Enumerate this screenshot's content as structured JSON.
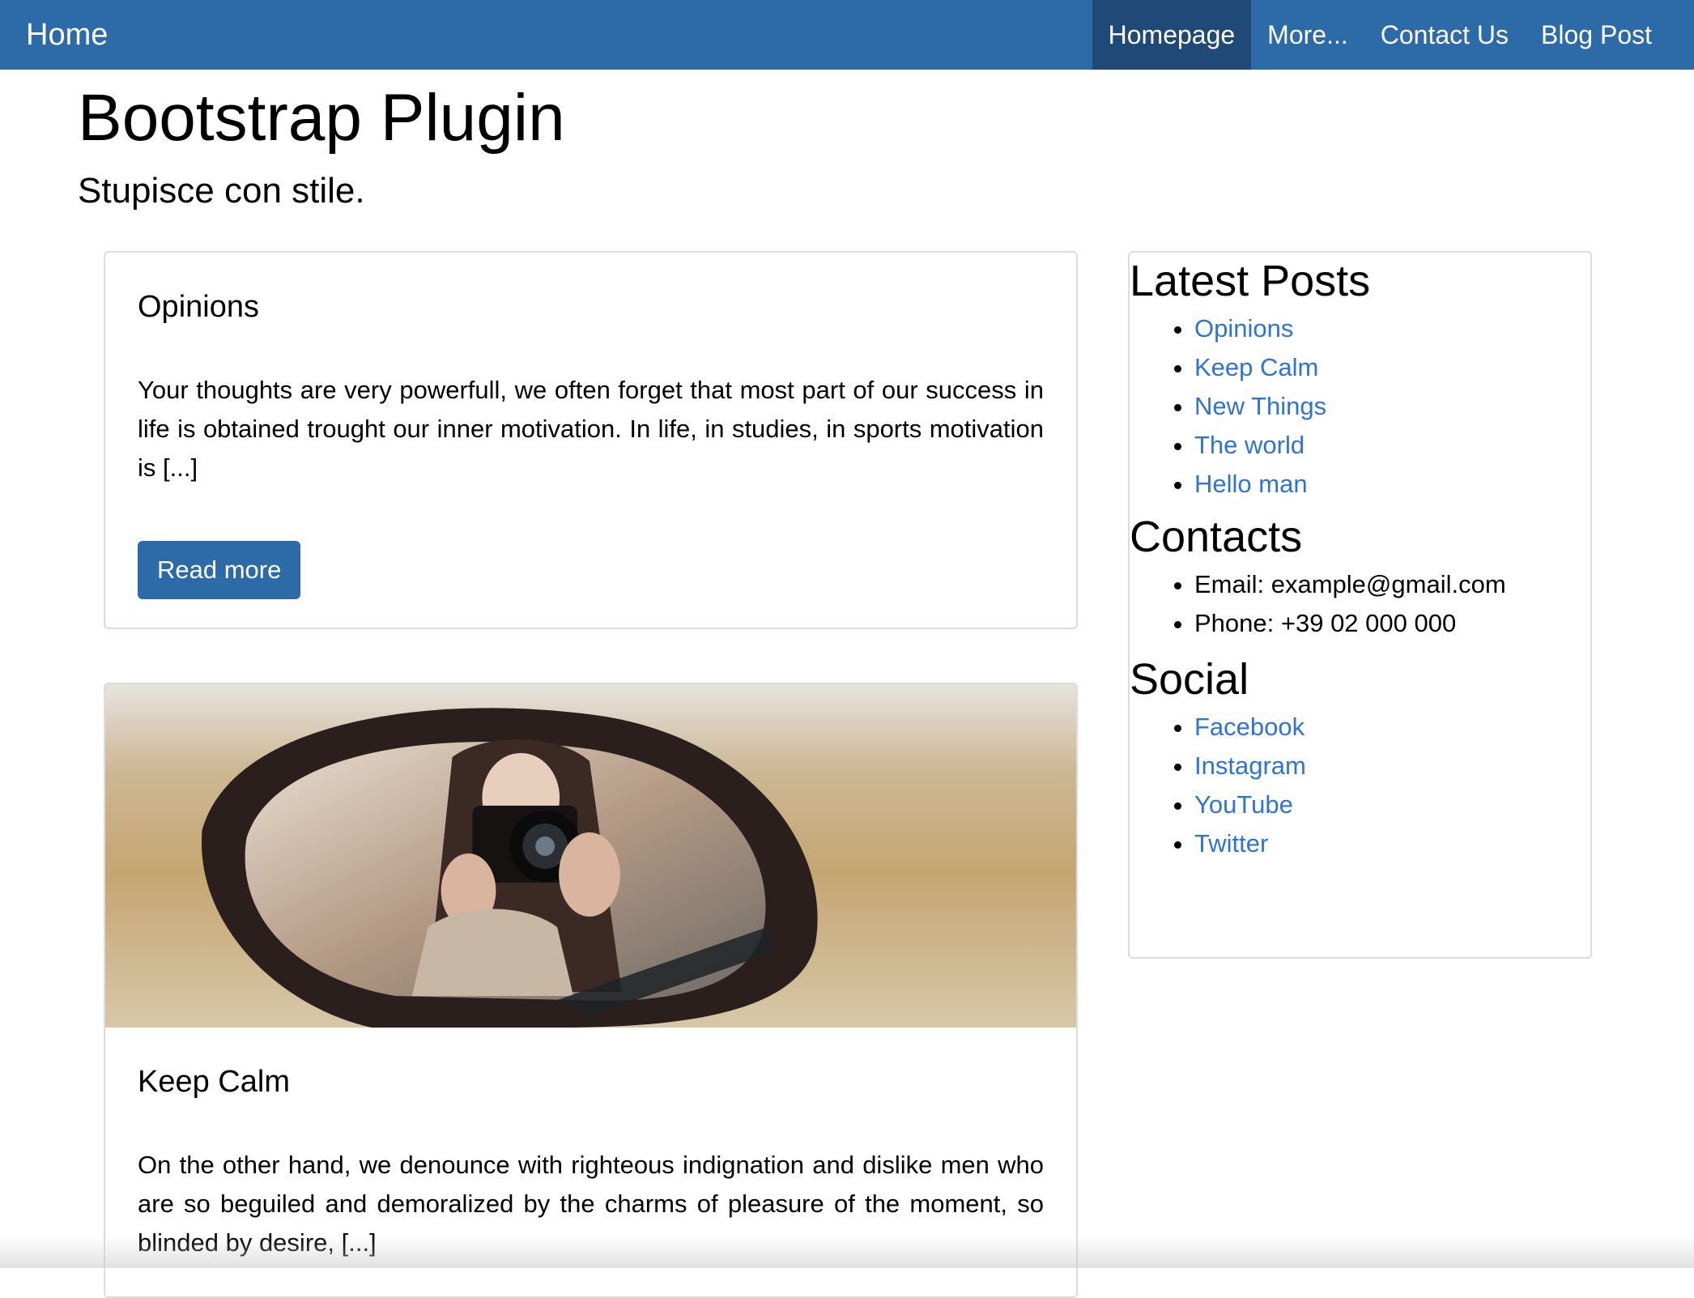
{
  "navbar": {
    "brand": "Home",
    "links": [
      {
        "label": "Homepage",
        "active": true
      },
      {
        "label": "More..."
      },
      {
        "label": "Contact Us"
      },
      {
        "label": "Blog Post"
      }
    ]
  },
  "header": {
    "title": "Bootstrap Plugin",
    "subtitle": "Stupisce con stile."
  },
  "posts": [
    {
      "title": "Opinions",
      "excerpt": "Your thoughts are very powerfull, we often forget that most part of our success in life is obtained trought our inner motivation. In life, in studies, in sports motivation is [...]",
      "button": "Read more"
    },
    {
      "title": "Keep Calm",
      "image": "camera-in-car-mirror-photo",
      "excerpt": "On the other hand, we denounce with righteous indignation and dislike men who are so beguiled and demoralized by the charms of pleasure of the moment, so blinded by desire, [...]"
    }
  ],
  "sidebar": {
    "latest_heading": "Latest Posts",
    "latest": [
      "Opinions",
      "Keep Calm",
      "New Things",
      "The world",
      "Hello man"
    ],
    "contacts_heading": "Contacts",
    "contacts": [
      "Email: example@gmail.com",
      "Phone: +39 02 000 000"
    ],
    "social_heading": "Social",
    "social": [
      "Facebook",
      "Instagram",
      "YouTube",
      "Twitter"
    ]
  },
  "colors": {
    "navbar": "#2d6aa8",
    "navbar_active": "#1f4a78",
    "link": "#2e73d6",
    "button": "#2d6aa8"
  }
}
